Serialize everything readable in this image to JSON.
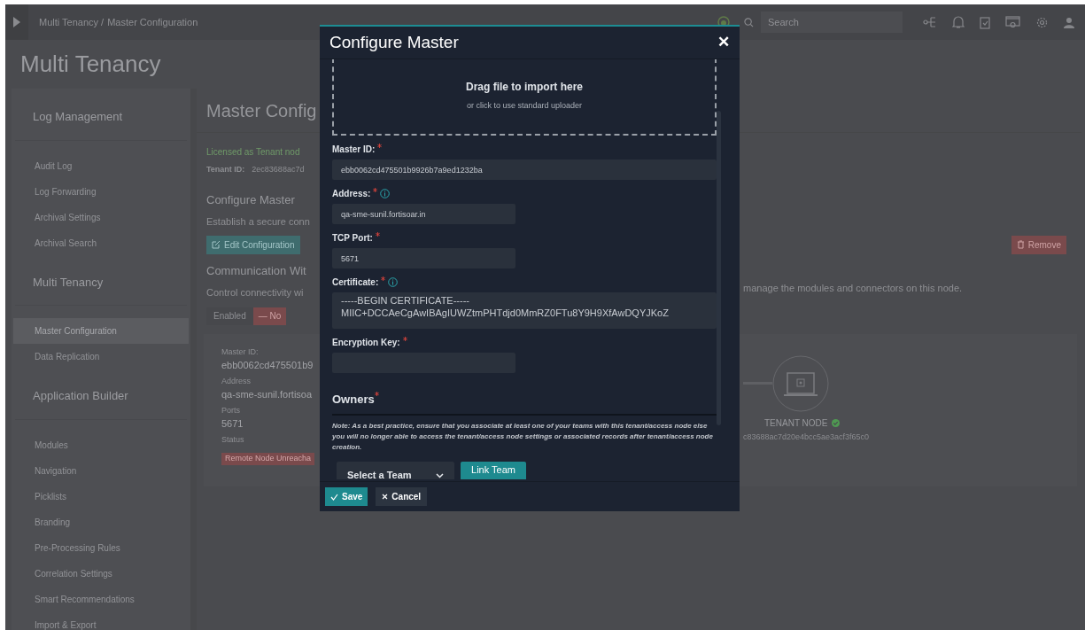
{
  "topbar": {
    "breadcrumb": [
      "Multi Tenancy /",
      "Master Configuration"
    ],
    "search": {
      "placeholder": "Search"
    }
  },
  "page_title": "Multi Tenancy",
  "sidebar": {
    "sections": [
      {
        "title": "Log Management",
        "items": [
          {
            "label": "Audit Log",
            "selected": false
          },
          {
            "label": "Log Forwarding",
            "selected": false
          },
          {
            "label": "Archival Settings",
            "selected": false
          },
          {
            "label": "Archival Search",
            "selected": false
          }
        ]
      },
      {
        "title": "Multi Tenancy",
        "items": [
          {
            "label": "Master Configuration",
            "selected": true
          },
          {
            "label": "Data Replication",
            "selected": false
          }
        ]
      },
      {
        "title": "Application Builder",
        "items": [
          {
            "label": "Modules",
            "selected": false
          },
          {
            "label": "Navigation",
            "selected": false
          },
          {
            "label": "Picklists",
            "selected": false
          },
          {
            "label": "Branding",
            "selected": false
          },
          {
            "label": "Pre-Processing Rules",
            "selected": false
          },
          {
            "label": "Correlation Settings",
            "selected": false
          },
          {
            "label": "Smart Recommendations",
            "selected": false
          },
          {
            "label": "Import & Export",
            "selected": false
          }
        ]
      }
    ]
  },
  "main": {
    "title": "Master Config",
    "license": "Licensed as Tenant nod",
    "tenant_id_label": "Tenant ID:",
    "tenant_id": "2ec83688ac7d",
    "configure_title": "Configure Master",
    "configure_text": "Establish a secure conn",
    "edit_button": "Edit Configuration",
    "remove_button": "Remove",
    "comm_title": "Communication Wit",
    "comm_text": "Control connectivity wi",
    "comm_text_right": "manage the modules and connectors on this node.",
    "toggle": {
      "label": "Enabled",
      "value": "— No",
      "on": false
    },
    "card": {
      "fields": [
        {
          "label": "Master ID:",
          "value": "ebb0062cd475501b9"
        },
        {
          "label": "Address",
          "value": "qa-sme-sunil.fortisoa"
        },
        {
          "label": "Ports",
          "value": "5671"
        }
      ],
      "status_label": "Status",
      "status": "Remote Node Unreacha",
      "node": {
        "title": "TENANT NODE",
        "ok": true,
        "id": "c83688ac7d20e4bcc5ae3acf3f65c0"
      }
    }
  },
  "modal": {
    "title": "Configure Master",
    "close": "✕",
    "dropzone": {
      "title": "Drag file to import here",
      "subtitle": "or click to use standard uploader"
    },
    "fields": [
      {
        "kind": "input",
        "label": "Master ID:",
        "required": true,
        "info": false,
        "value": "ebb0062cd475501b9926b7a9ed1232ba",
        "wide": true
      },
      {
        "kind": "input",
        "label": "Address:",
        "required": true,
        "info": true,
        "value": "qa-sme-sunil.fortisoar.in",
        "wide": false
      },
      {
        "kind": "input",
        "label": "TCP Port:",
        "required": true,
        "info": false,
        "value": "5671",
        "wide": false
      },
      {
        "kind": "textarea",
        "label": "Certificate:",
        "required": true,
        "info": true,
        "lines": [
          "-----BEGIN CERTIFICATE-----",
          "MIIC+DCCAeCgAwIBAgIUWZtmPHTdjd0MmRZ0FTu8Y9H9XfAwDQYJKoZ"
        ],
        "wide": true
      },
      {
        "kind": "input",
        "label": "Encryption Key:",
        "required": true,
        "info": false,
        "wide": false
      }
    ],
    "owners": {
      "title": "Owners",
      "required": true,
      "note": "Note: As a best practice, ensure that you associate at least one of your teams with this tenant/access node else you will no longer able to access the tenant/access node settings or associated records after tenant/access node creation.",
      "select": "Select a Team",
      "link_button": "Link Team"
    },
    "save": "Save",
    "cancel": "Cancel"
  }
}
